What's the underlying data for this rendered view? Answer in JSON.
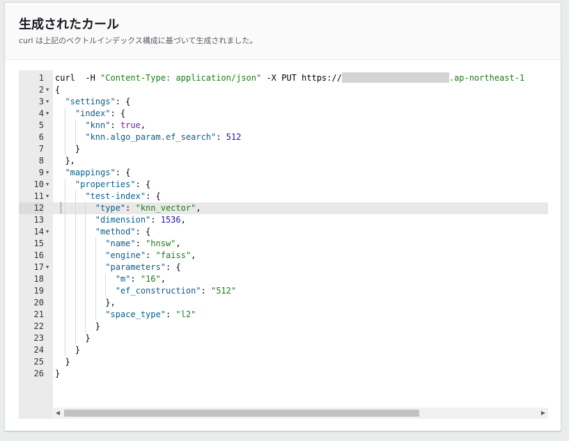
{
  "header": {
    "title": "生成されたカール",
    "description": "curl は上記のベクトルインデックス構成に基づいて生成されました。"
  },
  "editor": {
    "active_line": 12,
    "scroll_arrow_left": "◀",
    "scroll_arrow_right": "▶",
    "fold_marker": "▼",
    "lines": [
      {
        "no": "1",
        "fold": false,
        "tokens": [
          {
            "t": "curl  -H ",
            "c": "pun"
          },
          {
            "t": "\"Content-Type: application/json\"",
            "c": "str"
          },
          {
            "t": " -X PUT https://",
            "c": "pun"
          },
          {
            "t": "",
            "c": "redact"
          },
          {
            "t": ".ap-northeast-1",
            "c": "str"
          }
        ]
      },
      {
        "no": "2",
        "fold": true,
        "tokens": [
          {
            "t": "{",
            "c": "pun"
          }
        ]
      },
      {
        "no": "3",
        "fold": true,
        "tokens": [
          {
            "t": "  ",
            "c": "pun"
          },
          {
            "t": "\"settings\"",
            "c": "key"
          },
          {
            "t": ": {",
            "c": "pun"
          }
        ]
      },
      {
        "no": "4",
        "fold": true,
        "tokens": [
          {
            "t": "    ",
            "c": "pun"
          },
          {
            "t": "\"index\"",
            "c": "key"
          },
          {
            "t": ": {",
            "c": "pun"
          }
        ]
      },
      {
        "no": "5",
        "fold": false,
        "tokens": [
          {
            "t": "      ",
            "c": "pun"
          },
          {
            "t": "\"knn\"",
            "c": "key"
          },
          {
            "t": ": ",
            "c": "pun"
          },
          {
            "t": "true",
            "c": "bool"
          },
          {
            "t": ",",
            "c": "pun"
          }
        ]
      },
      {
        "no": "6",
        "fold": false,
        "tokens": [
          {
            "t": "      ",
            "c": "pun"
          },
          {
            "t": "\"knn.algo_param.ef_search\"",
            "c": "key"
          },
          {
            "t": ": ",
            "c": "pun"
          },
          {
            "t": "512",
            "c": "num"
          }
        ]
      },
      {
        "no": "7",
        "fold": false,
        "tokens": [
          {
            "t": "    }",
            "c": "pun"
          }
        ]
      },
      {
        "no": "8",
        "fold": false,
        "tokens": [
          {
            "t": "  },",
            "c": "pun"
          }
        ]
      },
      {
        "no": "9",
        "fold": true,
        "tokens": [
          {
            "t": "  ",
            "c": "pun"
          },
          {
            "t": "\"mappings\"",
            "c": "key"
          },
          {
            "t": ": {",
            "c": "pun"
          }
        ]
      },
      {
        "no": "10",
        "fold": true,
        "tokens": [
          {
            "t": "    ",
            "c": "pun"
          },
          {
            "t": "\"properties\"",
            "c": "key"
          },
          {
            "t": ": {",
            "c": "pun"
          }
        ]
      },
      {
        "no": "11",
        "fold": true,
        "tokens": [
          {
            "t": "      ",
            "c": "pun"
          },
          {
            "t": "\"test-index\"",
            "c": "key"
          },
          {
            "t": ": {",
            "c": "pun"
          }
        ]
      },
      {
        "no": "12",
        "fold": false,
        "tokens": [
          {
            "t": "        ",
            "c": "pun"
          },
          {
            "t": "\"type\"",
            "c": "key"
          },
          {
            "t": ": ",
            "c": "pun"
          },
          {
            "t": "\"knn_vector\"",
            "c": "str"
          },
          {
            "t": ",",
            "c": "pun"
          }
        ]
      },
      {
        "no": "13",
        "fold": false,
        "tokens": [
          {
            "t": "        ",
            "c": "pun"
          },
          {
            "t": "\"dimension\"",
            "c": "key"
          },
          {
            "t": ": ",
            "c": "pun"
          },
          {
            "t": "1536",
            "c": "num"
          },
          {
            "t": ",",
            "c": "pun"
          }
        ]
      },
      {
        "no": "14",
        "fold": true,
        "tokens": [
          {
            "t": "        ",
            "c": "pun"
          },
          {
            "t": "\"method\"",
            "c": "key"
          },
          {
            "t": ": {",
            "c": "pun"
          }
        ]
      },
      {
        "no": "15",
        "fold": false,
        "tokens": [
          {
            "t": "          ",
            "c": "pun"
          },
          {
            "t": "\"name\"",
            "c": "key"
          },
          {
            "t": ": ",
            "c": "pun"
          },
          {
            "t": "\"hnsw\"",
            "c": "str"
          },
          {
            "t": ",",
            "c": "pun"
          }
        ]
      },
      {
        "no": "16",
        "fold": false,
        "tokens": [
          {
            "t": "          ",
            "c": "pun"
          },
          {
            "t": "\"engine\"",
            "c": "key"
          },
          {
            "t": ": ",
            "c": "pun"
          },
          {
            "t": "\"faiss\"",
            "c": "str"
          },
          {
            "t": ",",
            "c": "pun"
          }
        ]
      },
      {
        "no": "17",
        "fold": true,
        "tokens": [
          {
            "t": "          ",
            "c": "pun"
          },
          {
            "t": "\"parameters\"",
            "c": "key"
          },
          {
            "t": ": {",
            "c": "pun"
          }
        ]
      },
      {
        "no": "18",
        "fold": false,
        "tokens": [
          {
            "t": "            ",
            "c": "pun"
          },
          {
            "t": "\"m\"",
            "c": "key"
          },
          {
            "t": ": ",
            "c": "pun"
          },
          {
            "t": "\"16\"",
            "c": "str"
          },
          {
            "t": ",",
            "c": "pun"
          }
        ]
      },
      {
        "no": "19",
        "fold": false,
        "tokens": [
          {
            "t": "            ",
            "c": "pun"
          },
          {
            "t": "\"ef_construction\"",
            "c": "key"
          },
          {
            "t": ": ",
            "c": "pun"
          },
          {
            "t": "\"512\"",
            "c": "str"
          }
        ]
      },
      {
        "no": "20",
        "fold": false,
        "tokens": [
          {
            "t": "          },",
            "c": "pun"
          }
        ]
      },
      {
        "no": "21",
        "fold": false,
        "tokens": [
          {
            "t": "          ",
            "c": "pun"
          },
          {
            "t": "\"space_type\"",
            "c": "key"
          },
          {
            "t": ": ",
            "c": "pun"
          },
          {
            "t": "\"l2\"",
            "c": "str"
          }
        ]
      },
      {
        "no": "22",
        "fold": false,
        "tokens": [
          {
            "t": "        }",
            "c": "pun"
          }
        ]
      },
      {
        "no": "23",
        "fold": false,
        "tokens": [
          {
            "t": "      }",
            "c": "pun"
          }
        ]
      },
      {
        "no": "24",
        "fold": false,
        "tokens": [
          {
            "t": "    }",
            "c": "pun"
          }
        ]
      },
      {
        "no": "25",
        "fold": false,
        "tokens": [
          {
            "t": "  }",
            "c": "pun"
          }
        ]
      },
      {
        "no": "26",
        "fold": false,
        "tokens": [
          {
            "t": "}",
            "c": "pun"
          }
        ]
      }
    ]
  }
}
